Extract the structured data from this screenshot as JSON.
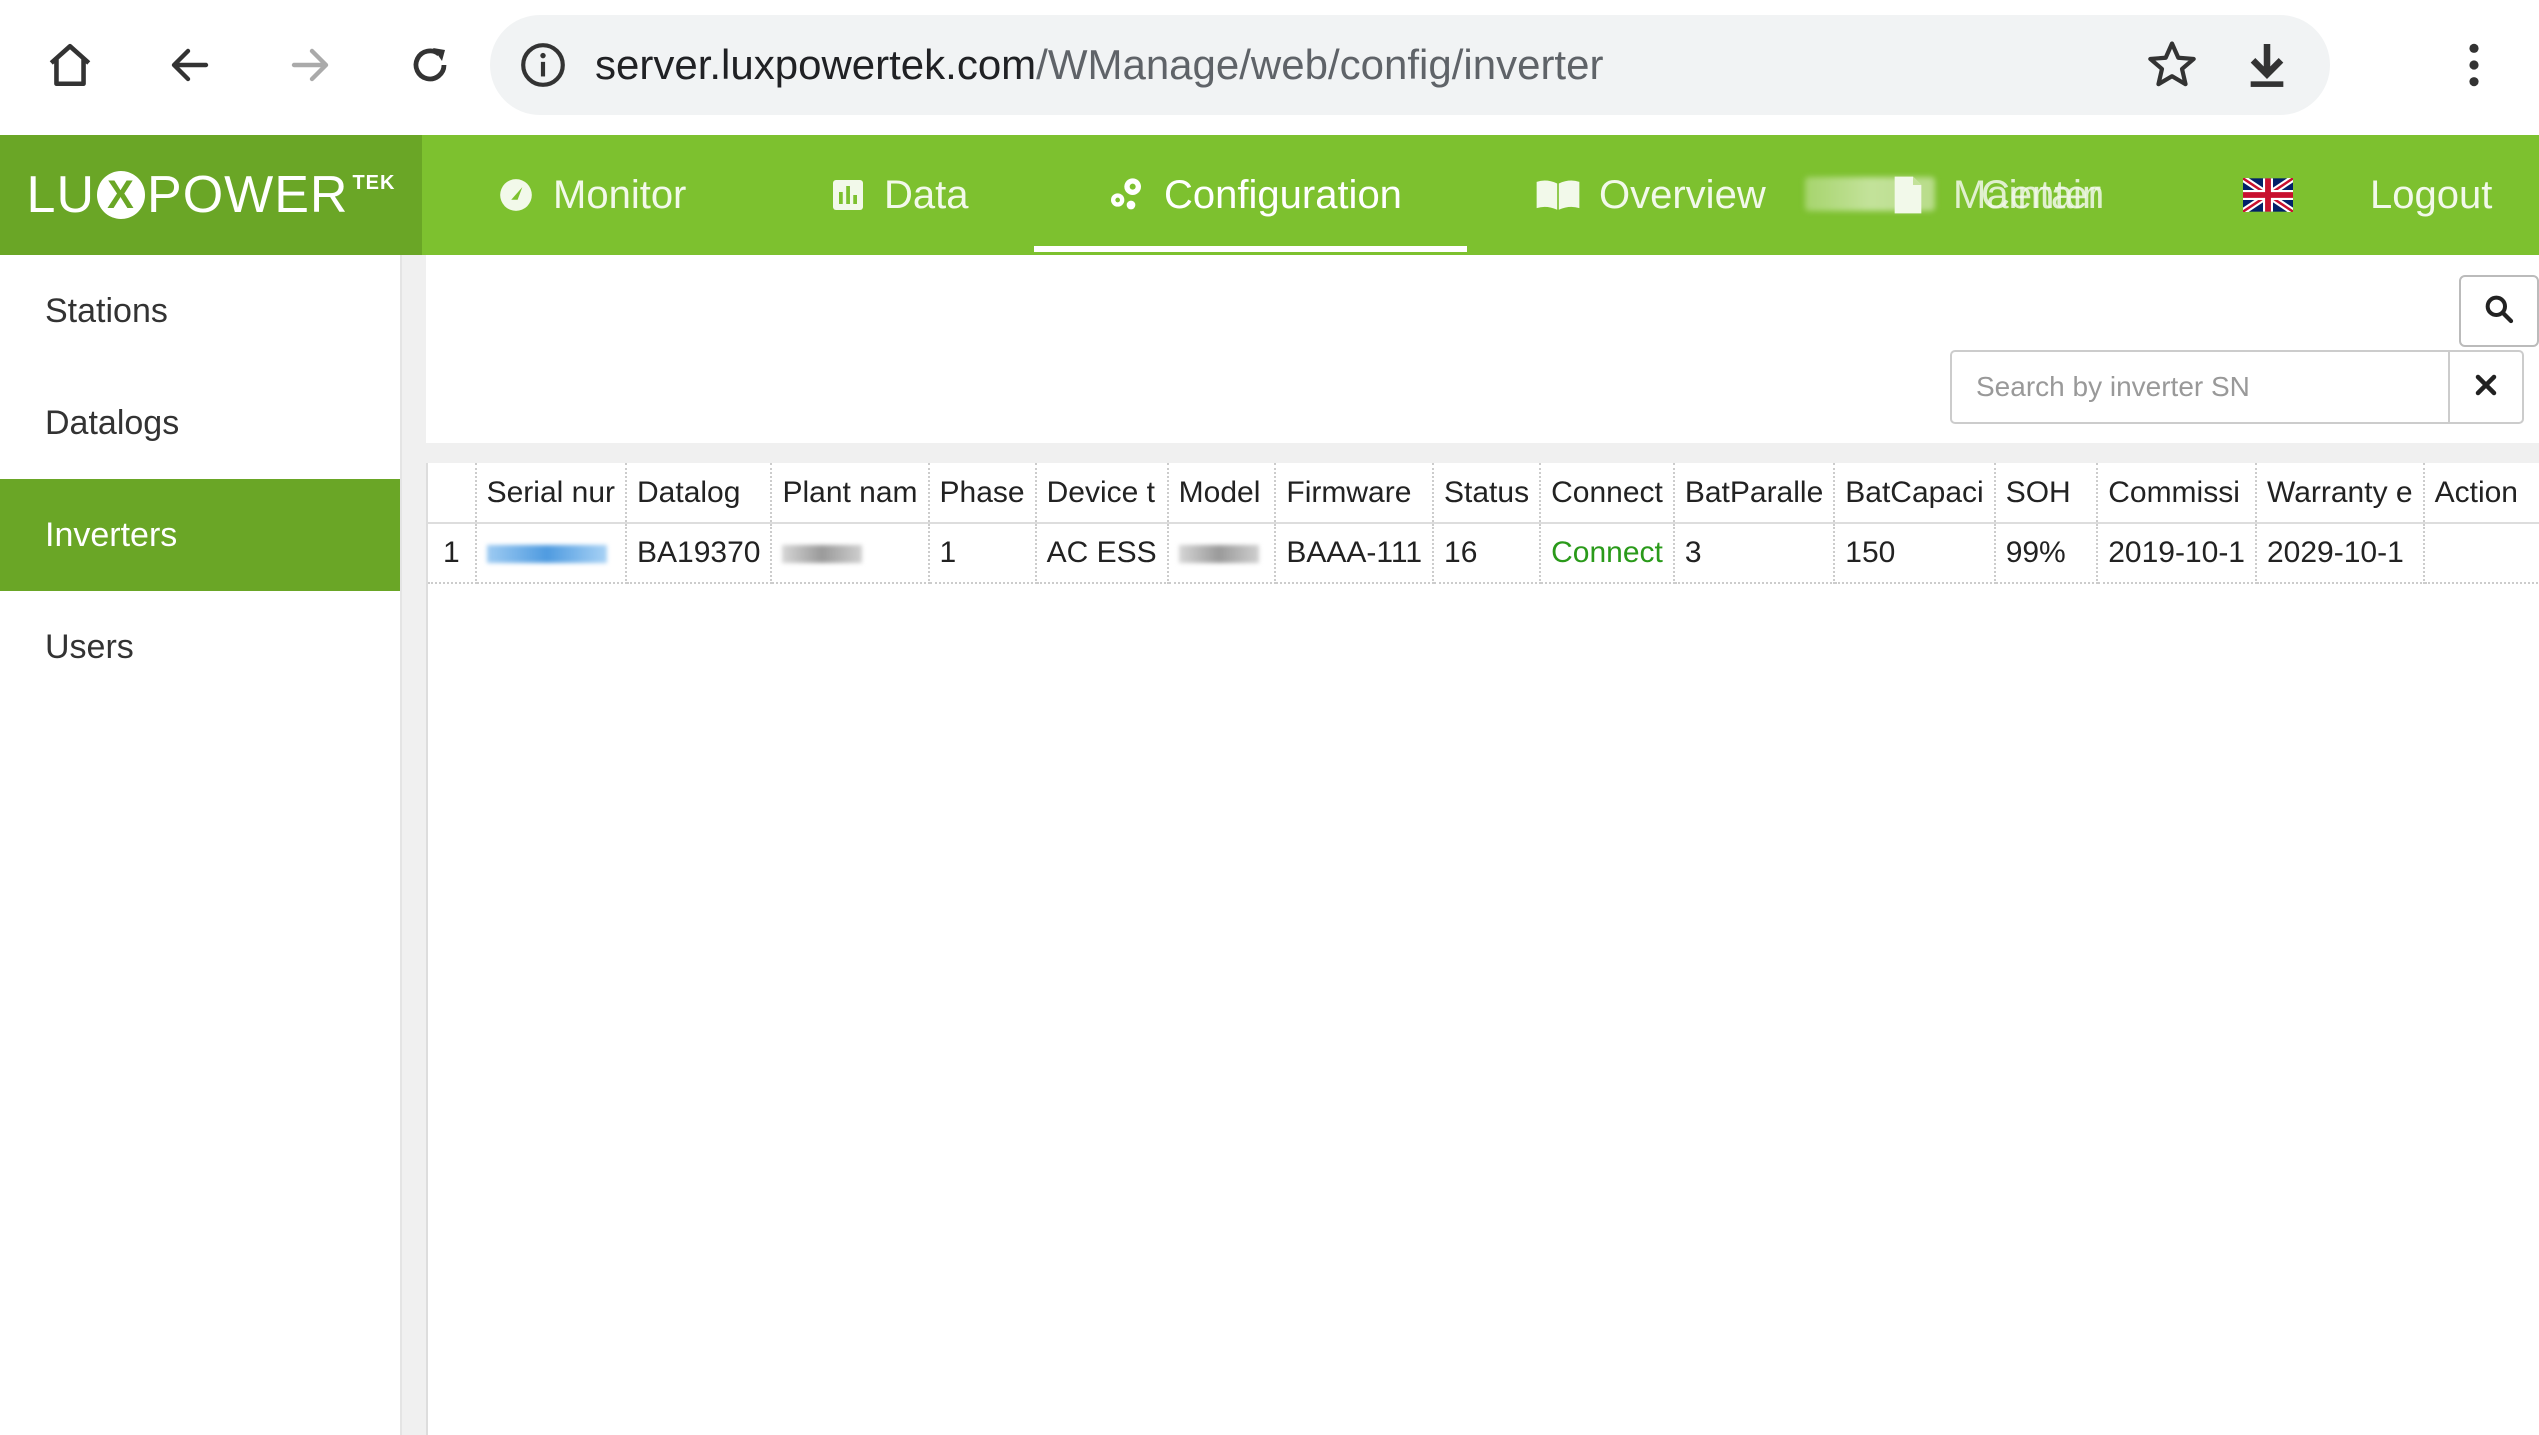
{
  "browser": {
    "url_host": "server.luxpowertek.com",
    "url_path": "/WManage/web/config/inverter"
  },
  "app": {
    "logo_text_left": "LU",
    "logo_x": "X",
    "logo_text_right": "POWER",
    "logo_sup": "TEK",
    "menu": {
      "monitor": "Monitor",
      "data": "Data",
      "configuration": "Configuration",
      "overview": "Overview",
      "maintain": "Maintain",
      "center": "Center",
      "logout": "Logout"
    },
    "active_menu": "Configuration"
  },
  "sidebar": {
    "items": [
      {
        "label": "Stations"
      },
      {
        "label": "Datalogs"
      },
      {
        "label": "Inverters"
      },
      {
        "label": "Users"
      }
    ],
    "active": "Inverters"
  },
  "search": {
    "placeholder": "Search by inverter SN"
  },
  "table": {
    "columns": [
      "",
      "Serial nur",
      "Datalog",
      "Plant nam",
      "Phase",
      "Device t",
      "Model",
      "Firmware",
      "Status",
      "Connect",
      "BatParalle",
      "BatCapaci",
      "SOH",
      "Commissi",
      "Warranty e",
      "Action"
    ],
    "rows": [
      {
        "index": "1",
        "serial": "",
        "datalog": "BA19370",
        "plant": "",
        "phase": "1",
        "device_type": "AC ESS",
        "model": "",
        "firmware": "BAAA-111",
        "status": "16",
        "connect": "Connect",
        "bat_parallel": "3",
        "bat_capacity": "150",
        "soh": "99%",
        "commission": "2019-10-1",
        "warranty": "2029-10-1",
        "action": ""
      }
    ]
  },
  "colors": {
    "header_green": "#7dc12f",
    "logo_green": "#6aa626",
    "connect_green": "#2a9a1a"
  }
}
